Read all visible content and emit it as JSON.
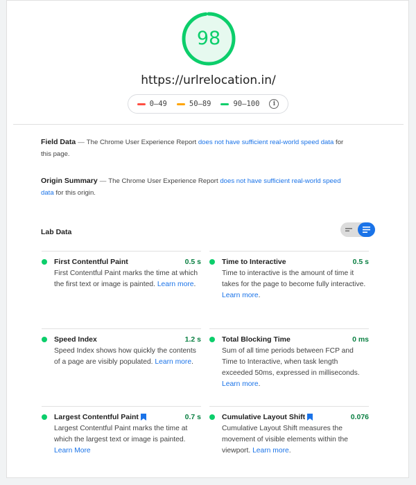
{
  "score": {
    "value": "98",
    "fraction": 0.98,
    "color": "#0cce6b",
    "track_color": "#e6f9ef"
  },
  "url": "https://urlrelocation.in/",
  "legend": [
    {
      "label": "0–49",
      "color": "#ff4e42"
    },
    {
      "label": "50–89",
      "color": "#ffa400"
    },
    {
      "label": "90–100",
      "color": "#0cce6b"
    }
  ],
  "legend_icon": "info-icon",
  "field_data": {
    "title": "Field Data",
    "dash": "—",
    "text_before": "The Chrome User Experience Report ",
    "link": "does not have sufficient real-world speed data",
    "text_after": " for this page."
  },
  "origin_summary": {
    "title": "Origin Summary",
    "dash": "—",
    "text_before": "The Chrome User Experience Report ",
    "link": "does not have sufficient real-world speed data",
    "text_after": " for this origin."
  },
  "lab_data": {
    "title": "Lab Data",
    "toggle_icons": [
      "list-compact-icon",
      "list-expanded-icon"
    ],
    "metrics": [
      {
        "name": "First Contentful Paint",
        "value": "0.5 s",
        "desc": "First Contentful Paint marks the time at which the first text or image is painted. ",
        "link": "Learn more",
        "link_after": ".",
        "bookmark": false
      },
      {
        "name": "Time to Interactive",
        "value": "0.5 s",
        "desc": "Time to interactive is the amount of time it takes for the page to become fully interactive. ",
        "link": "Learn more",
        "link_after": ".",
        "bookmark": false
      },
      {
        "name": "Speed Index",
        "value": "1.2 s",
        "desc": "Speed Index shows how quickly the contents of a page are visibly populated. ",
        "link": "Learn more",
        "link_after": ".",
        "bookmark": false
      },
      {
        "name": "Total Blocking Time",
        "value": "0 ms",
        "desc": "Sum of all time periods between FCP and Time to Interactive, when task length exceeded 50ms, expressed in milliseconds. ",
        "link": "Learn more",
        "link_after": ".",
        "bookmark": false
      },
      {
        "name": "Largest Contentful Paint",
        "value": "0.7 s",
        "desc": "Largest Contentful Paint marks the time at which the largest text or image is painted. ",
        "link": "Learn More",
        "link_after": "",
        "bookmark": true
      },
      {
        "name": "Cumulative Layout Shift",
        "value": "0.076",
        "desc": "Cumulative Layout Shift measures the movement of visible elements within the viewport. ",
        "link": "Learn more",
        "link_after": ".",
        "bookmark": true
      }
    ]
  }
}
